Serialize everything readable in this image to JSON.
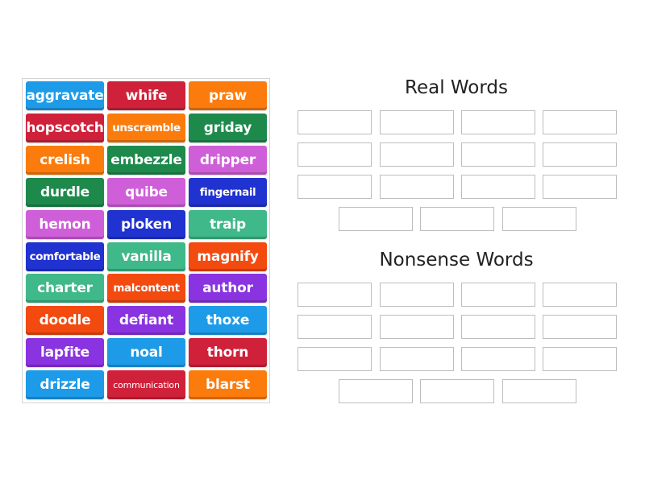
{
  "cards": [
    {
      "label": "aggravate",
      "color": "#1e9be8"
    },
    {
      "label": "whife",
      "color": "#d0213a"
    },
    {
      "label": "praw",
      "color": "#fb7c0c"
    },
    {
      "label": "hopscotch",
      "color": "#d0213a"
    },
    {
      "label": "unscramble",
      "color": "#fb7c0c"
    },
    {
      "label": "griday",
      "color": "#1d8a4c"
    },
    {
      "label": "crelish",
      "color": "#fb7c0c"
    },
    {
      "label": "embezzle",
      "color": "#1d8a4c"
    },
    {
      "label": "dripper",
      "color": "#cf5fd8"
    },
    {
      "label": "durdle",
      "color": "#1d8a4c"
    },
    {
      "label": "quibe",
      "color": "#cf5fd8"
    },
    {
      "label": "fingernail",
      "color": "#2032cf"
    },
    {
      "label": "hemon",
      "color": "#cf5fd8"
    },
    {
      "label": "ploken",
      "color": "#2032cf"
    },
    {
      "label": "traip",
      "color": "#3fb88a"
    },
    {
      "label": "comfortable",
      "color": "#2032cf"
    },
    {
      "label": "vanilla",
      "color": "#3fb88a"
    },
    {
      "label": "magnify",
      "color": "#f34a0f"
    },
    {
      "label": "charter",
      "color": "#3fb88a"
    },
    {
      "label": "malcontent",
      "color": "#f34a0f"
    },
    {
      "label": "author",
      "color": "#8a33e0"
    },
    {
      "label": "doodle",
      "color": "#f34a0f"
    },
    {
      "label": "defiant",
      "color": "#8a33e0"
    },
    {
      "label": "thoxe",
      "color": "#1e9be8"
    },
    {
      "label": "lapfite",
      "color": "#8a33e0"
    },
    {
      "label": "noal",
      "color": "#1e9be8"
    },
    {
      "label": "thorn",
      "color": "#d0213a"
    },
    {
      "label": "drizzle",
      "color": "#1e9be8"
    },
    {
      "label": "communication",
      "color": "#d0213a"
    },
    {
      "label": "blarst",
      "color": "#fb7c0c"
    }
  ],
  "groups": [
    {
      "title": "Real Words",
      "slot_count": 15
    },
    {
      "title": "Nonsense Words",
      "slot_count": 15
    }
  ]
}
